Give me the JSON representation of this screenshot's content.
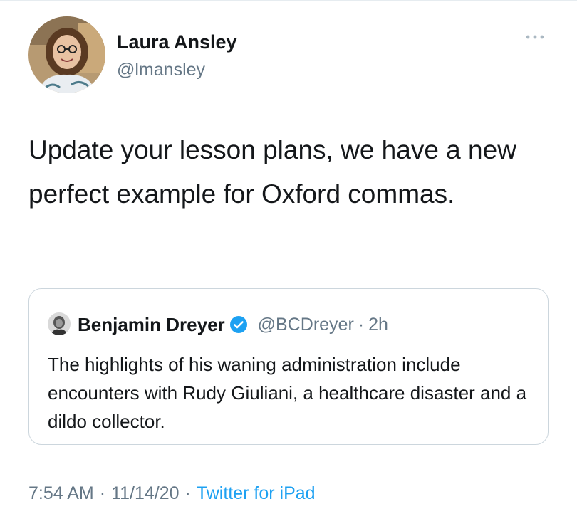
{
  "tweet": {
    "author": {
      "name": "Laura Ansley",
      "handle": "@lmansley"
    },
    "more_icon": "ellipsis-icon",
    "text": "Update your lesson plans, we have a new perfect example for Oxford commas.",
    "quoted": {
      "author": {
        "name": "Benjamin Dreyer",
        "handle": "@BCDreyer",
        "verified": true,
        "verified_icon": "verified-badge-icon",
        "time": "2h"
      },
      "separator": "·",
      "text": "The highlights of his waning administration include encounters with Rudy Giuliani, a healthcare disaster and a dildo collector."
    },
    "meta": {
      "time": "7:54 AM",
      "date": "11/14/20",
      "source": "Twitter for iPad",
      "separator": "·"
    }
  },
  "colors": {
    "text": "#14171a",
    "secondary": "#657786",
    "link": "#1da1f2",
    "border": "#ccd6dd",
    "verified": "#1da1f2"
  }
}
